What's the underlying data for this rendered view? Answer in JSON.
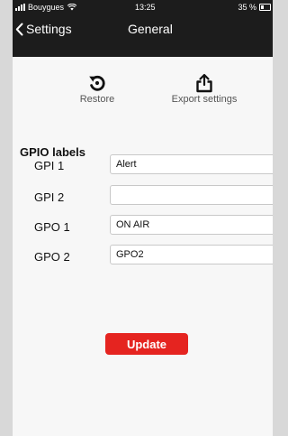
{
  "status_bar": {
    "carrier": "Bouygues",
    "time": "13:25",
    "battery": "35 %"
  },
  "nav": {
    "back_label": "Settings",
    "title": "General"
  },
  "toolbar": {
    "restore_label": "Restore",
    "export_label": "Export settings"
  },
  "gpio": {
    "section_title": "GPIO labels",
    "rows": [
      {
        "label": "GPI 1",
        "value": "Alert"
      },
      {
        "label": "GPI 2",
        "value": ""
      },
      {
        "label": "GPO 1",
        "value": "ON AIR"
      },
      {
        "label": "GPO 2",
        "value": "GPO2"
      }
    ]
  },
  "update_label": "Update",
  "colors": {
    "nav_background": "#1c1c1c",
    "accent_red": "#e52420",
    "page_background": "#f7f7f7"
  },
  "icons": {
    "restore": "restore-icon",
    "export": "share-icon",
    "back": "chevron-left-icon"
  }
}
